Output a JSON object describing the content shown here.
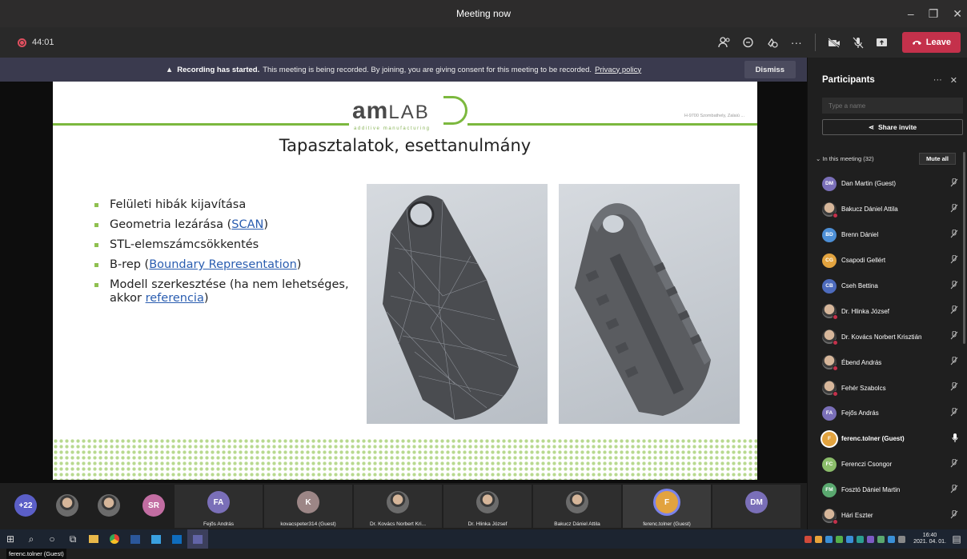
{
  "window": {
    "title": "Meeting now"
  },
  "toolbar": {
    "timer": "44:01",
    "leave_label": "Leave"
  },
  "banner": {
    "bold": "Recording has started.",
    "text": "This meeting is being recorded. By joining, you are giving consent for this meeting to be recorded.",
    "link": "Privacy policy",
    "dismiss": "Dismiss"
  },
  "slide": {
    "logo_am": "am",
    "logo_lab": "LAB",
    "logo_sub": "additive manufacturing",
    "address": "H-9700 Szombathely, Zalaiú ...",
    "title": "Tapasztalatok, esettanulmány",
    "bullets": [
      {
        "pre": "Felületi hibák kijavítása",
        "link": "",
        "post": ""
      },
      {
        "pre": "Geometria lezárása (",
        "link": "SCAN",
        "post": ")"
      },
      {
        "pre": "STL-elemszámcsökkentés",
        "link": "",
        "post": ""
      },
      {
        "pre": "B-rep (",
        "link": "Boundary Representation",
        "post": ")"
      },
      {
        "pre": "Modell szerkesztése (ha nem lehetséges, akkor ",
        "link": "referencia",
        "post": ")"
      }
    ]
  },
  "presenter_tag": "ferenc.tolner (Guest)",
  "strip": {
    "overflow_count": "+22",
    "thumbs": [
      {
        "initials": "SR",
        "color": "#c26da2",
        "name": ""
      },
      {
        "initials": "FA",
        "color": "#7a6fb8",
        "name": "Fejős András"
      },
      {
        "initials": "K",
        "color": "#9c8686",
        "name": "kovacspeter314 (Guest)"
      },
      {
        "initials": "",
        "color": "",
        "name": "Dr. Kovács Norbert Kri..."
      },
      {
        "initials": "",
        "color": "",
        "name": "Dr. Hlinka József"
      },
      {
        "initials": "",
        "color": "",
        "name": "Bakucz Dániel Attila"
      },
      {
        "initials": "F",
        "color": "#e2a33f",
        "name": "ferenc.tolner (Guest)"
      },
      {
        "initials": "DM",
        "color": "#7a6fb8",
        "name": ""
      }
    ]
  },
  "panel": {
    "title": "Participants",
    "search_placeholder": "Type a name",
    "share_invite": "Share invite",
    "section": "In this meeting (32)",
    "mute_all": "Mute all",
    "participants": [
      {
        "name": "Dan Martin (Guest)",
        "initials": "DM",
        "color": "#7a6fb8",
        "photo": false,
        "speaking": false
      },
      {
        "name": "Bakucz Dániel Attila",
        "initials": "",
        "color": "",
        "photo": true,
        "speaking": false
      },
      {
        "name": "Brenn Dániel",
        "initials": "BD",
        "color": "#4d8fd6",
        "photo": false,
        "speaking": false
      },
      {
        "name": "Csapodi Gellért",
        "initials": "CG",
        "color": "#e2a33f",
        "photo": false,
        "speaking": false
      },
      {
        "name": "Cseh Bettina",
        "initials": "CB",
        "color": "#4d6bbd",
        "photo": false,
        "speaking": false
      },
      {
        "name": "Dr. Hlinka József",
        "initials": "",
        "color": "",
        "photo": true,
        "speaking": false
      },
      {
        "name": "Dr. Kovács Norbert Krisztián",
        "initials": "",
        "color": "",
        "photo": true,
        "speaking": false
      },
      {
        "name": "Ébend András",
        "initials": "",
        "color": "",
        "photo": true,
        "speaking": false
      },
      {
        "name": "Fehér Szabolcs",
        "initials": "",
        "color": "",
        "photo": true,
        "speaking": false
      },
      {
        "name": "Fejős András",
        "initials": "FA",
        "color": "#7a6fb8",
        "photo": false,
        "speaking": false
      },
      {
        "name": "ferenc.tolner (Guest)",
        "initials": "F",
        "color": "#e2a33f",
        "photo": false,
        "speaking": true
      },
      {
        "name": "Ferenczi Csongor",
        "initials": "FC",
        "color": "#8bbd6a",
        "photo": false,
        "speaking": false
      },
      {
        "name": "Fosztó Dániel Martin",
        "initials": "FM",
        "color": "#5aa86f",
        "photo": false,
        "speaking": false
      },
      {
        "name": "Hári Eszter",
        "initials": "",
        "color": "",
        "photo": true,
        "speaking": false
      }
    ]
  },
  "taskbar": {
    "time": "16:40",
    "date": "2021. 04. 01."
  }
}
